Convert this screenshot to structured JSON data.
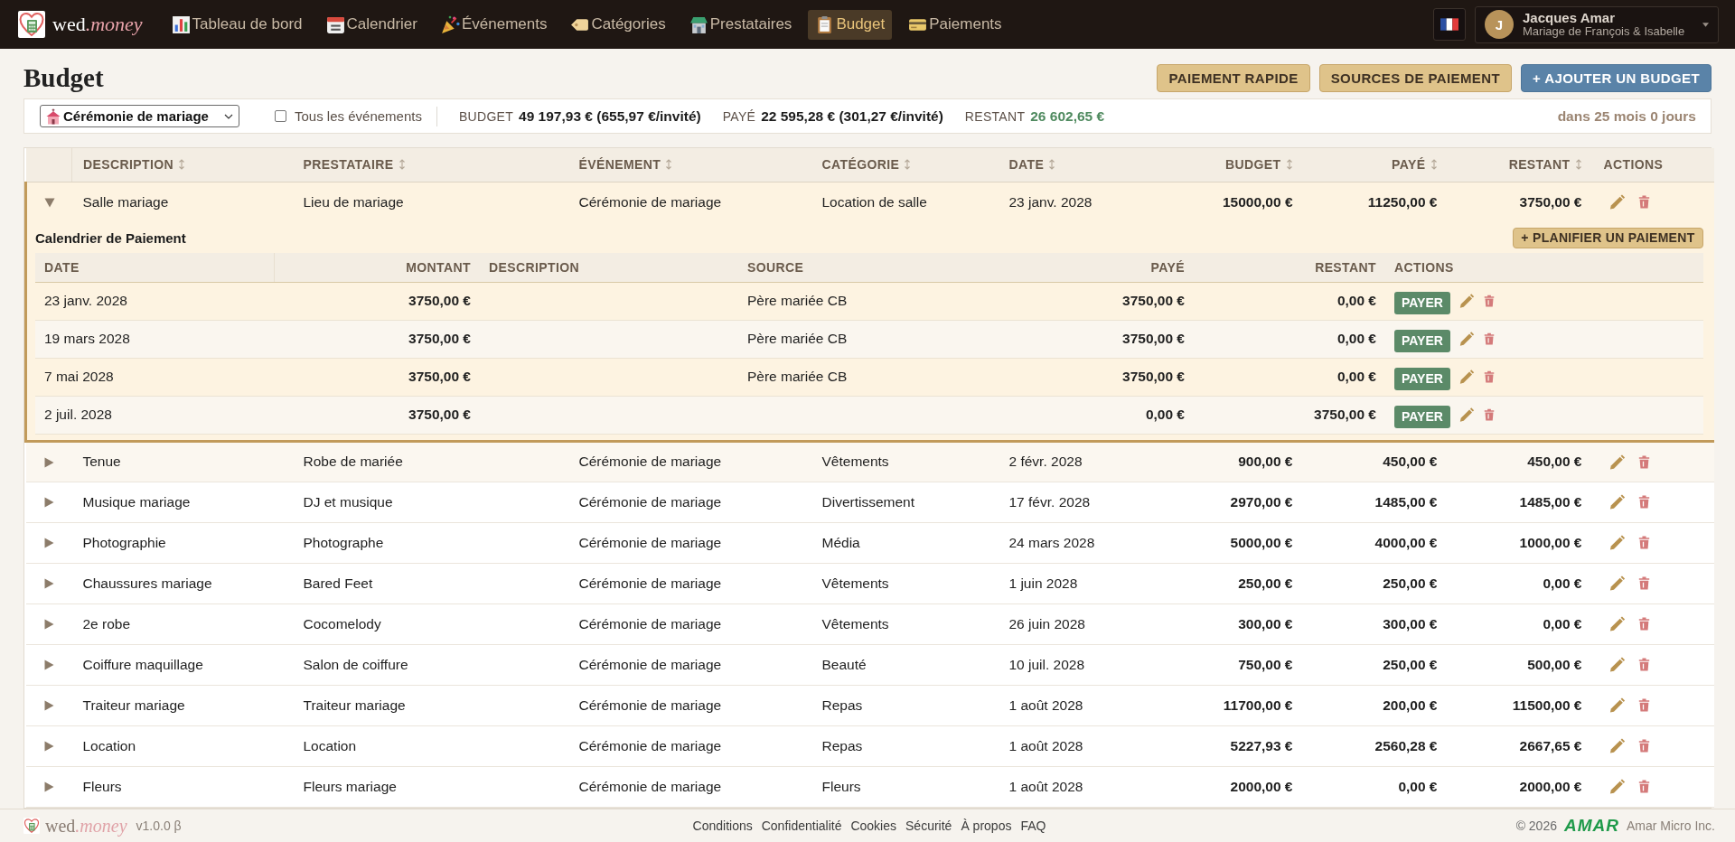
{
  "nav": {
    "logo": {
      "text": "wed",
      "accent": ".money"
    },
    "items": [
      {
        "label": "Tableau de bord",
        "kind": "dashboard",
        "selected": false
      },
      {
        "label": "Calendrier",
        "kind": "calendar",
        "selected": false
      },
      {
        "label": "Événements",
        "kind": "events",
        "selected": false
      },
      {
        "label": "Catégories",
        "kind": "categories",
        "selected": false
      },
      {
        "label": "Prestataires",
        "kind": "vendors",
        "selected": false
      },
      {
        "label": "Budget",
        "kind": "budget",
        "selected": true
      },
      {
        "label": "Paiements",
        "kind": "payments",
        "selected": false
      }
    ],
    "user": {
      "initial": "J",
      "name": "Jacques Amar",
      "subtitle": "Mariage de François & Isabelle"
    }
  },
  "page": {
    "title": "Budget",
    "actions": [
      {
        "label": "PAIEMENT RAPIDE",
        "kind": "secondary"
      },
      {
        "label": "SOURCES DE PAIEMENT",
        "kind": "secondary"
      },
      {
        "label": "+ AJOUTER UN BUDGET",
        "kind": "primary"
      }
    ]
  },
  "filters": {
    "event_select": "Cérémonie de mariage",
    "all_events": {
      "label": "Tous les événements",
      "checked": false
    },
    "stats": [
      {
        "label": "BUDGET",
        "value": "49 197,93 € (655,97 €/invité)",
        "kind": "neutral"
      },
      {
        "label": "PAYÉ",
        "value": "22 595,28 € (301,27 €/invité)",
        "kind": "neutral"
      },
      {
        "label": "RESTANT",
        "value": "26 602,65 €",
        "kind": "positive"
      }
    ],
    "countdown": "dans 25 mois 0 jours"
  },
  "table": {
    "columns": [
      {
        "label": "DESCRIPTION",
        "kind": "text",
        "sortable": true
      },
      {
        "label": "PRESTATAIRE",
        "kind": "text",
        "sortable": true
      },
      {
        "label": "ÉVÉNEMENT",
        "kind": "text",
        "sortable": true
      },
      {
        "label": "CATÉGORIE",
        "kind": "text",
        "sortable": true
      },
      {
        "label": "DATE",
        "kind": "text",
        "sortable": true
      },
      {
        "label": "BUDGET",
        "kind": "amount",
        "sortable": true
      },
      {
        "label": "PAYÉ",
        "kind": "amount",
        "sortable": true
      },
      {
        "label": "RESTANT",
        "kind": "amount",
        "sortable": true
      },
      {
        "label": "ACTIONS",
        "kind": "actions",
        "sortable": false
      }
    ],
    "rows": [
      {
        "cells": [
          "Salle mariage",
          "Lieu de mariage",
          "Cérémonie de mariage",
          "Location de salle",
          "23 janv. 2028",
          "15000,00 €",
          "11250,00 €",
          "3750,00 €"
        ],
        "expanded": true,
        "highlighted": false,
        "schedule": {
          "title": "Calendrier de Paiement",
          "add_button": "+ PLANIFIER UN PAIEMENT",
          "columns": [
            {
              "label": "DATE",
              "kind": "text"
            },
            {
              "label": "MONTANT",
              "kind": "amount"
            },
            {
              "label": "DESCRIPTION",
              "kind": "text"
            },
            {
              "label": "SOURCE",
              "kind": "text"
            },
            {
              "label": "PAYÉ",
              "kind": "amount"
            },
            {
              "label": "RESTANT",
              "kind": "amount"
            },
            {
              "label": "ACTIONS",
              "kind": "actions"
            }
          ],
          "rows": [
            {
              "cells": [
                "23 janv. 2028",
                "3750,00 €",
                null,
                "Père mariée CB",
                "3750,00 €",
                "0,00 €"
              ],
              "pay_button": "PAYER"
            },
            {
              "cells": [
                "19 mars 2028",
                "3750,00 €",
                null,
                "Père mariée CB",
                "3750,00 €",
                "0,00 €"
              ],
              "pay_button": "PAYER"
            },
            {
              "cells": [
                "7 mai 2028",
                "3750,00 €",
                null,
                "Père mariée CB",
                "3750,00 €",
                "0,00 €"
              ],
              "pay_button": "PAYER"
            },
            {
              "cells": [
                "2 juil. 2028",
                "3750,00 €",
                null,
                null,
                "0,00 €",
                "3750,00 €"
              ],
              "pay_button": "PAYER"
            }
          ]
        }
      },
      {
        "cells": [
          "Tenue",
          "Robe de mariée",
          "Cérémonie de mariage",
          "Vêtements",
          "2 févr. 2028",
          "900,00 €",
          "450,00 €",
          "450,00 €"
        ],
        "expanded": false,
        "highlighted": true
      },
      {
        "cells": [
          "Musique mariage",
          "DJ et musique",
          "Cérémonie de mariage",
          "Divertissement",
          "17 févr. 2028",
          "2970,00 €",
          "1485,00 €",
          "1485,00 €"
        ],
        "expanded": false,
        "highlighted": false
      },
      {
        "cells": [
          "Photographie",
          "Photographe",
          "Cérémonie de mariage",
          "Média",
          "24 mars 2028",
          "5000,00 €",
          "4000,00 €",
          "1000,00 €"
        ],
        "expanded": false,
        "highlighted": false
      },
      {
        "cells": [
          "Chaussures mariage",
          "Bared Feet",
          "Cérémonie de mariage",
          "Vêtements",
          "1 juin 2028",
          "250,00 €",
          "250,00 €",
          "0,00 €"
        ],
        "expanded": false,
        "highlighted": false
      },
      {
        "cells": [
          "2e robe",
          "Cocomelody",
          "Cérémonie de mariage",
          "Vêtements",
          "26 juin 2028",
          "300,00 €",
          "300,00 €",
          "0,00 €"
        ],
        "expanded": false,
        "highlighted": false
      },
      {
        "cells": [
          "Coiffure maquillage",
          "Salon de coiffure",
          "Cérémonie de mariage",
          "Beauté",
          "10 juil. 2028",
          "750,00 €",
          "250,00 €",
          "500,00 €"
        ],
        "expanded": false,
        "highlighted": false
      },
      {
        "cells": [
          "Traiteur mariage",
          "Traiteur mariage",
          "Cérémonie de mariage",
          "Repas",
          "1 août 2028",
          "11700,00 €",
          "200,00 €",
          "11500,00 €"
        ],
        "expanded": false,
        "highlighted": false
      },
      {
        "cells": [
          "Location",
          "Location",
          "Cérémonie de mariage",
          "Repas",
          "1 août 2028",
          "5227,93 €",
          "2560,28 €",
          "2667,65 €"
        ],
        "expanded": false,
        "highlighted": false
      },
      {
        "cells": [
          "Fleurs",
          "Fleurs mariage",
          "Cérémonie de mariage",
          "Fleurs",
          "1 août 2028",
          "2000,00 €",
          "0,00 €",
          "2000,00 €"
        ],
        "expanded": false,
        "highlighted": false
      }
    ]
  },
  "footer": {
    "logo": {
      "text": "wed",
      "accent": ".money"
    },
    "version": "v1.0.0 β",
    "links": [
      "Conditions",
      "Confidentialité",
      "Cookies",
      "Sécurité",
      "À propos",
      "FAQ"
    ],
    "copyright": "© 2026",
    "company_logo": "AMAR",
    "company": "Amar Micro Inc."
  }
}
